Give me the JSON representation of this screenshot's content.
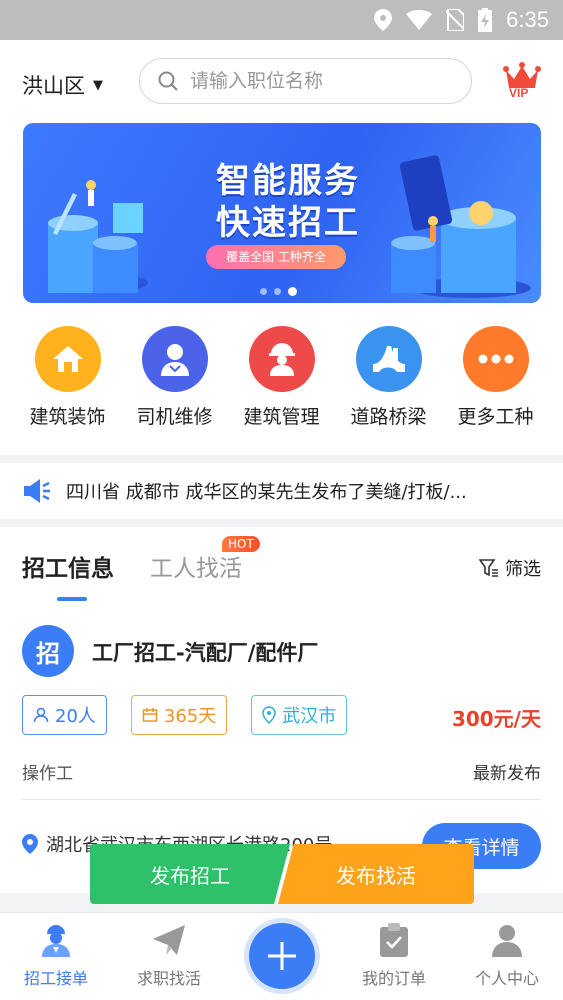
{
  "status_bar": {
    "time": "6:35"
  },
  "header": {
    "district": "洪山区",
    "search_placeholder": "请输入职位名称",
    "vip_label": "VIP"
  },
  "banner": {
    "title_line1": "智能服务",
    "title_line2": "快速招工",
    "subtitle": "覆盖全国 工种齐全",
    "active_slide": 3,
    "slide_count": 3
  },
  "categories": [
    {
      "label": "建筑装饰",
      "icon": "house-icon",
      "color": "#ffb21e"
    },
    {
      "label": "司机维修",
      "icon": "driver-icon",
      "color": "#4b63e8"
    },
    {
      "label": "建筑管理",
      "icon": "helmet-worker-icon",
      "color": "#ef4a4a"
    },
    {
      "label": "道路桥梁",
      "icon": "bridge-icon",
      "color": "#3b93f0"
    },
    {
      "label": "更多工种",
      "icon": "more-dots-icon",
      "color": "#ff7a2a"
    }
  ],
  "notice": {
    "text": "四川省 成都市 成华区的某先生发布了美缝/打板/..."
  },
  "tabs": {
    "recruit": "招工信息",
    "workers": "工人找活",
    "hot_badge": "HOT",
    "filter": "筛选"
  },
  "job": {
    "icon_char": "招",
    "title": "工厂招工-汽配厂/配件厂",
    "people": "20人",
    "days": "365天",
    "city": "武汉市",
    "salary": "300元/天",
    "type": "操作工",
    "status": "最新发布",
    "address": "湖北省武汉市东西湖区长港路200号",
    "detail_button": "查看详情"
  },
  "float_buttons": {
    "post_job": "发布招工",
    "post_work": "发布找活"
  },
  "tabbar": {
    "items": [
      {
        "label": "招工接单",
        "icon": "worker-icon"
      },
      {
        "label": "求职找活",
        "icon": "paper-plane-icon"
      },
      {
        "label": "我的订单",
        "icon": "clipboard-icon"
      },
      {
        "label": "个人中心",
        "icon": "person-icon"
      }
    ]
  }
}
